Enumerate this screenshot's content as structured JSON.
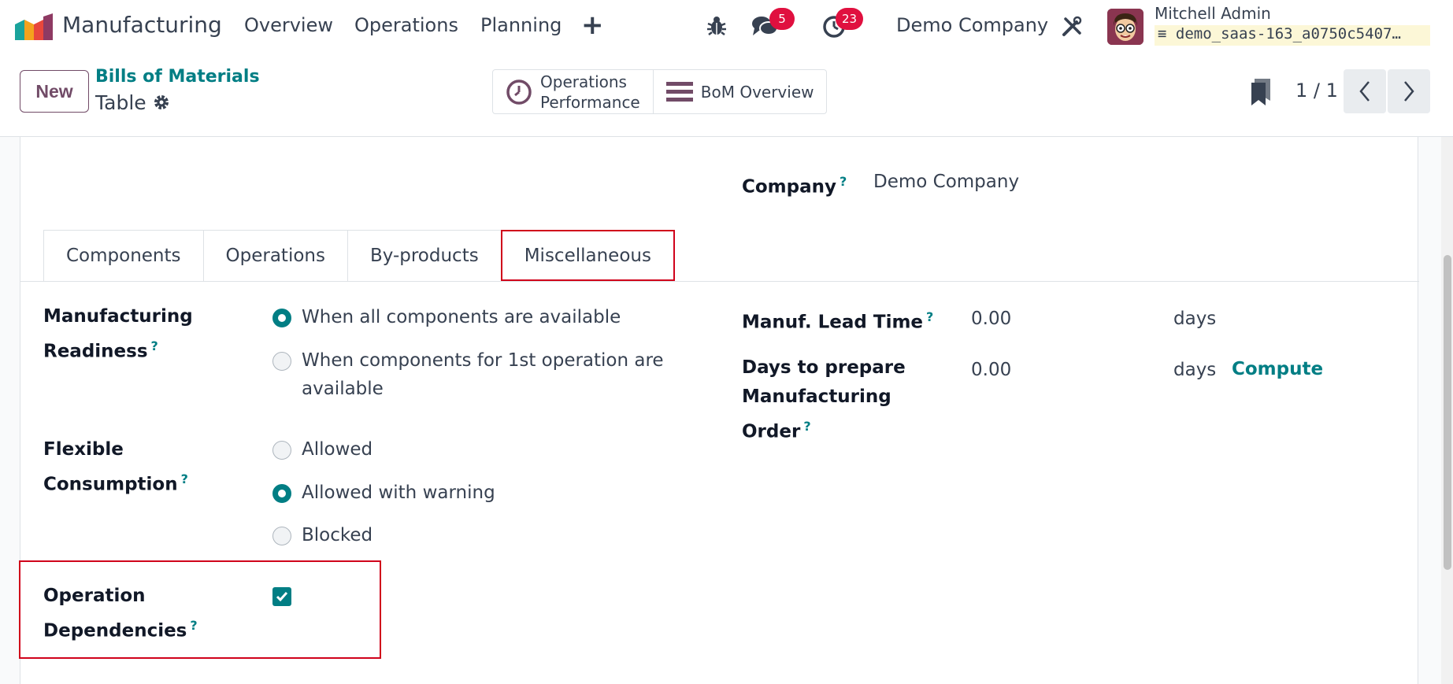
{
  "app": {
    "name": "Manufacturing"
  },
  "menu": [
    "Overview",
    "Operations",
    "Planning"
  ],
  "systray": {
    "messages_count": "5",
    "activities_count": "23",
    "company": "Demo Company"
  },
  "user": {
    "name": "Mitchell Admin",
    "database": "demo_saas-163_a0750c5407…"
  },
  "control": {
    "new_label": "New",
    "breadcrumb_parent": "Bills of Materials",
    "breadcrumb_current": "Table",
    "smart_buttons": [
      "Operations Performance",
      "BoM Overview"
    ],
    "smart_button_1_line1": "Operations",
    "smart_button_1_line2": "Performance",
    "pager": "1 / 1"
  },
  "form": {
    "company_label": "Company",
    "company_value": "Demo Company",
    "tabs": [
      "Components",
      "Operations",
      "By-products",
      "Miscellaneous"
    ],
    "active_tab": "Miscellaneous",
    "readiness_label_1": "Manufacturing",
    "readiness_label_2": "Readiness",
    "readiness_options": [
      "When all components are available",
      "When components for 1st operation are",
      "available"
    ],
    "flexible_label_1": "Flexible",
    "flexible_label_2": "Consumption",
    "flexible_options": [
      "Allowed",
      "Allowed with warning",
      "Blocked"
    ],
    "flexible_selected": "Allowed with warning",
    "dependencies_label_1": "Operation",
    "dependencies_label_2": "Dependencies",
    "dependencies_checked": true,
    "lead_time_label": "Manuf. Lead Time",
    "lead_time_value": "0.00",
    "lead_time_unit": "days",
    "prepare_label_1": "Days to prepare",
    "prepare_label_2": "Manufacturing",
    "prepare_label_3": "Order",
    "prepare_value": "0.00",
    "prepare_unit": "days",
    "compute_label": "Compute",
    "help_mark": "?"
  },
  "colors": {
    "accent": "#017e84",
    "brand": "#714b67",
    "highlight": "#d0021b",
    "badge": "#e0103f"
  }
}
